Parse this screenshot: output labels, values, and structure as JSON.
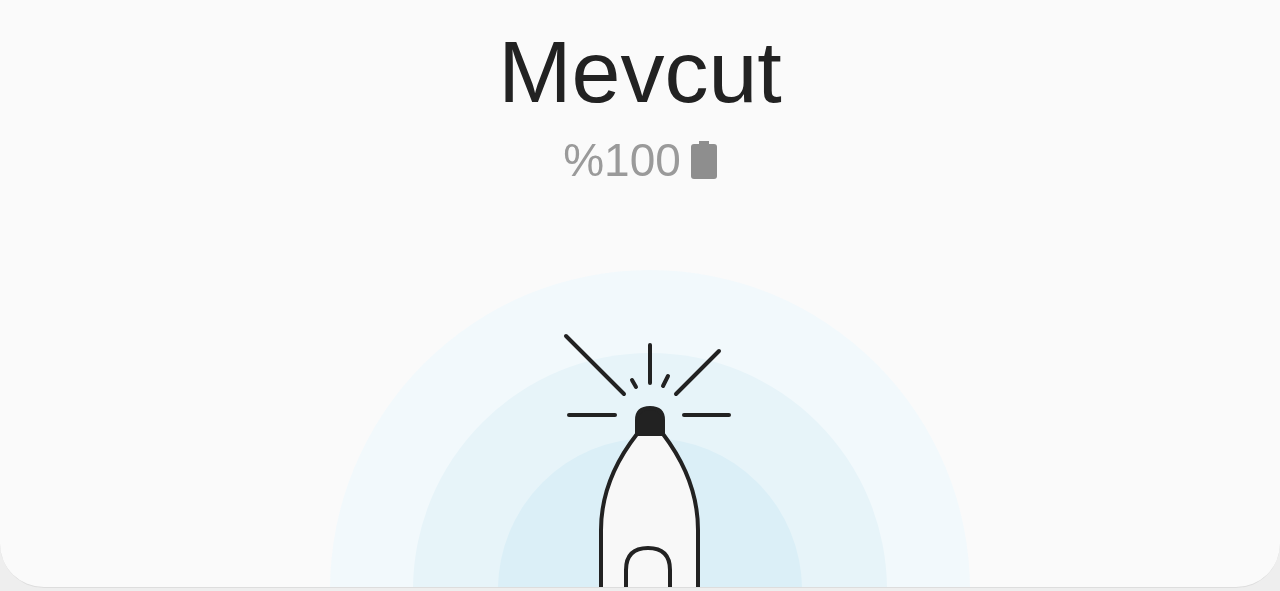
{
  "title": "Mevcut",
  "battery": {
    "text": "%100"
  }
}
